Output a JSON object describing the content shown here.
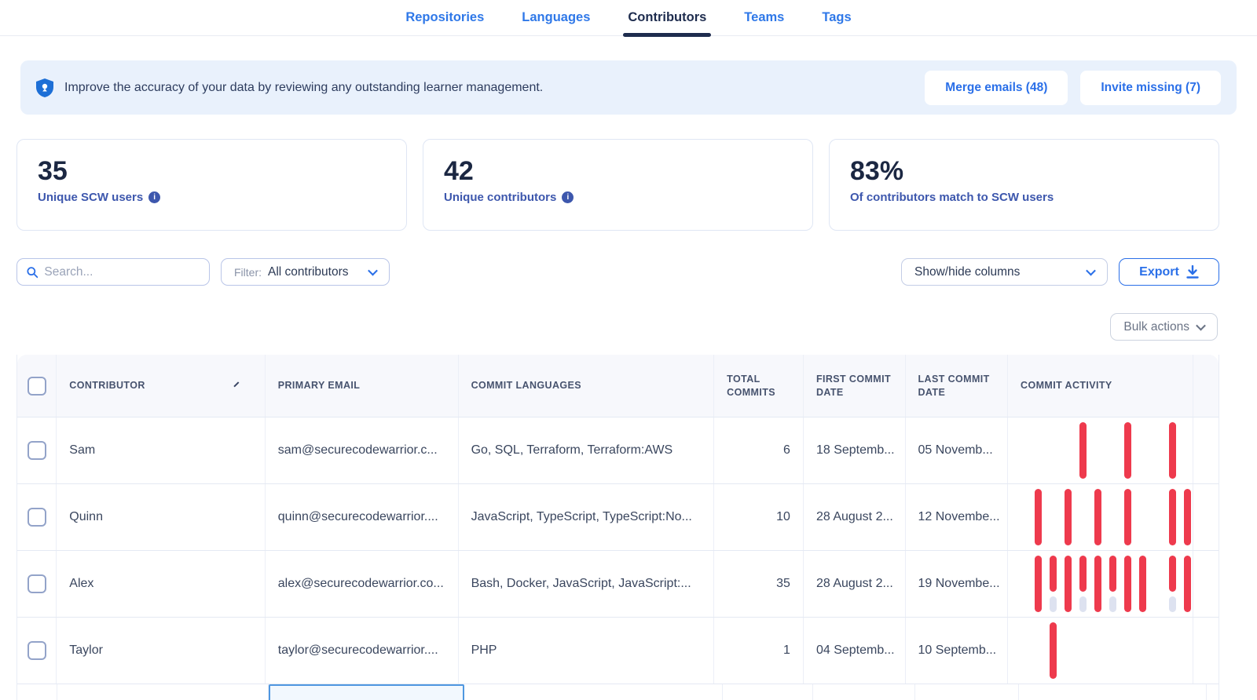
{
  "tabs": [
    {
      "label": "Repositories",
      "active": false
    },
    {
      "label": "Languages",
      "active": false
    },
    {
      "label": "Contributors",
      "active": true
    },
    {
      "label": "Teams",
      "active": false
    },
    {
      "label": "Tags",
      "active": false
    }
  ],
  "banner": {
    "text": "Improve the accuracy of your data by reviewing any outstanding learner management.",
    "merge_button": "Merge emails (48)",
    "invite_button": "Invite missing (7)"
  },
  "stats": [
    {
      "value": "35",
      "label": "Unique SCW users",
      "info": true
    },
    {
      "value": "42",
      "label": "Unique contributors",
      "info": true
    },
    {
      "value": "83%",
      "label": "Of contributors match to SCW users",
      "info": false
    }
  ],
  "controls": {
    "search_placeholder": "Search...",
    "filter_label": "Filter:",
    "filter_value": "All contributors",
    "show_hide_label": "Show/hide columns",
    "export_label": "Export",
    "bulk_actions_label": "Bulk actions"
  },
  "colors": {
    "accent_blue": "#2a6fe8",
    "active_tab": "#1e2c4e",
    "commit_bar_red": "#ee3a4d",
    "commit_bar_gray": "#dde2f0",
    "stat_label_blue": "#3d57ad"
  },
  "table": {
    "columns": [
      "Contributor",
      "Primary email",
      "Commit languages",
      "Total commits",
      "First commit date",
      "Last commit date",
      "Commit activity"
    ],
    "sorted_column": "Contributor",
    "rows": [
      {
        "contributor": "Sam",
        "email": "sam@securecodewarrior.c...",
        "languages": "Go, SQL, Terraform, Terraform:AWS",
        "total_commits": "6",
        "first_commit": "18 Septemb...",
        "last_commit": "05 Novemb...",
        "activity": [
          {
            "p": 3,
            "t": "tall"
          },
          {
            "p": 6,
            "t": "tall"
          },
          {
            "p": 9,
            "t": "tall"
          }
        ]
      },
      {
        "contributor": "Quinn",
        "email": "quinn@securecodewarrior....",
        "languages": "JavaScript, TypeScript, TypeScript:No...",
        "total_commits": "10",
        "first_commit": "28 August 2...",
        "last_commit": "12 Novembe...",
        "activity": [
          {
            "p": 0,
            "t": "tall"
          },
          {
            "p": 2,
            "t": "tall"
          },
          {
            "p": 4,
            "t": "tall"
          },
          {
            "p": 6,
            "t": "tall"
          },
          {
            "p": 9,
            "t": "tall"
          },
          {
            "p": 10,
            "t": "tall"
          }
        ]
      },
      {
        "contributor": "Alex",
        "email": "alex@securecodewarrior.co...",
        "languages": "Bash, Docker, JavaScript, JavaScript:...",
        "total_commits": "35",
        "first_commit": "28 August 2...",
        "last_commit": "19 Novembe...",
        "activity": [
          {
            "p": 0,
            "t": "tall"
          },
          {
            "p": 1,
            "t": "short",
            "g": true
          },
          {
            "p": 2,
            "t": "tall"
          },
          {
            "p": 3,
            "t": "short",
            "g": true
          },
          {
            "p": 4,
            "t": "tall"
          },
          {
            "p": 5,
            "t": "short",
            "g": true
          },
          {
            "p": 6,
            "t": "tall"
          },
          {
            "p": 7,
            "t": "tall"
          },
          {
            "p": 9,
            "t": "short",
            "g": true
          },
          {
            "p": 10,
            "t": "tall"
          },
          {
            "p": 11,
            "t": "tall"
          }
        ]
      },
      {
        "contributor": "Taylor",
        "email": "taylor@securecodewarrior....",
        "languages": "PHP",
        "total_commits": "1",
        "first_commit": "04 Septemb...",
        "last_commit": "10 Septemb...",
        "activity": [
          {
            "p": 1,
            "t": "tall"
          }
        ]
      }
    ]
  }
}
